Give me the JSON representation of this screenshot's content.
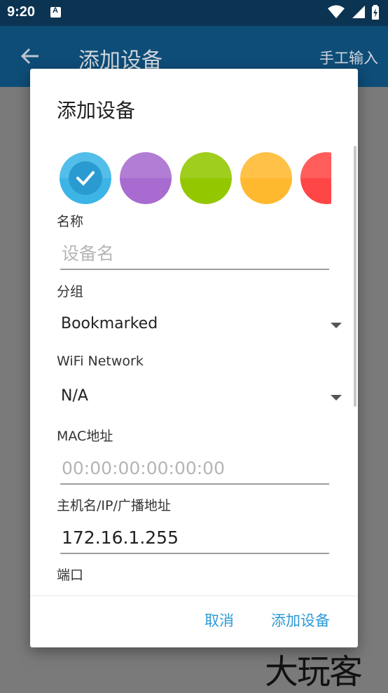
{
  "status_bar": {
    "time": "9:20"
  },
  "app_bar": {
    "title": "添加设备",
    "action": "手工输入"
  },
  "dialog": {
    "title": "添加设备",
    "colors": [
      "#3cb5e6",
      "#a86bcf",
      "#93c800",
      "#ffb92f",
      "#ff4646"
    ],
    "selected_color_index": 0,
    "fields": {
      "name": {
        "label": "名称",
        "placeholder": "设备名",
        "value": ""
      },
      "group": {
        "label": "分组",
        "value": "Bookmarked"
      },
      "wifi": {
        "label": "WiFi Network",
        "value": "N/A"
      },
      "mac": {
        "label": "MAC地址",
        "placeholder": "00:00:00:00:00:00",
        "value": ""
      },
      "host": {
        "label": "主机名/IP/广播地址",
        "value": "172.16.1.255"
      },
      "port": {
        "label": "端口"
      }
    },
    "buttons": {
      "cancel": "取消",
      "add": "添加设备"
    }
  },
  "watermark": "大玩客"
}
